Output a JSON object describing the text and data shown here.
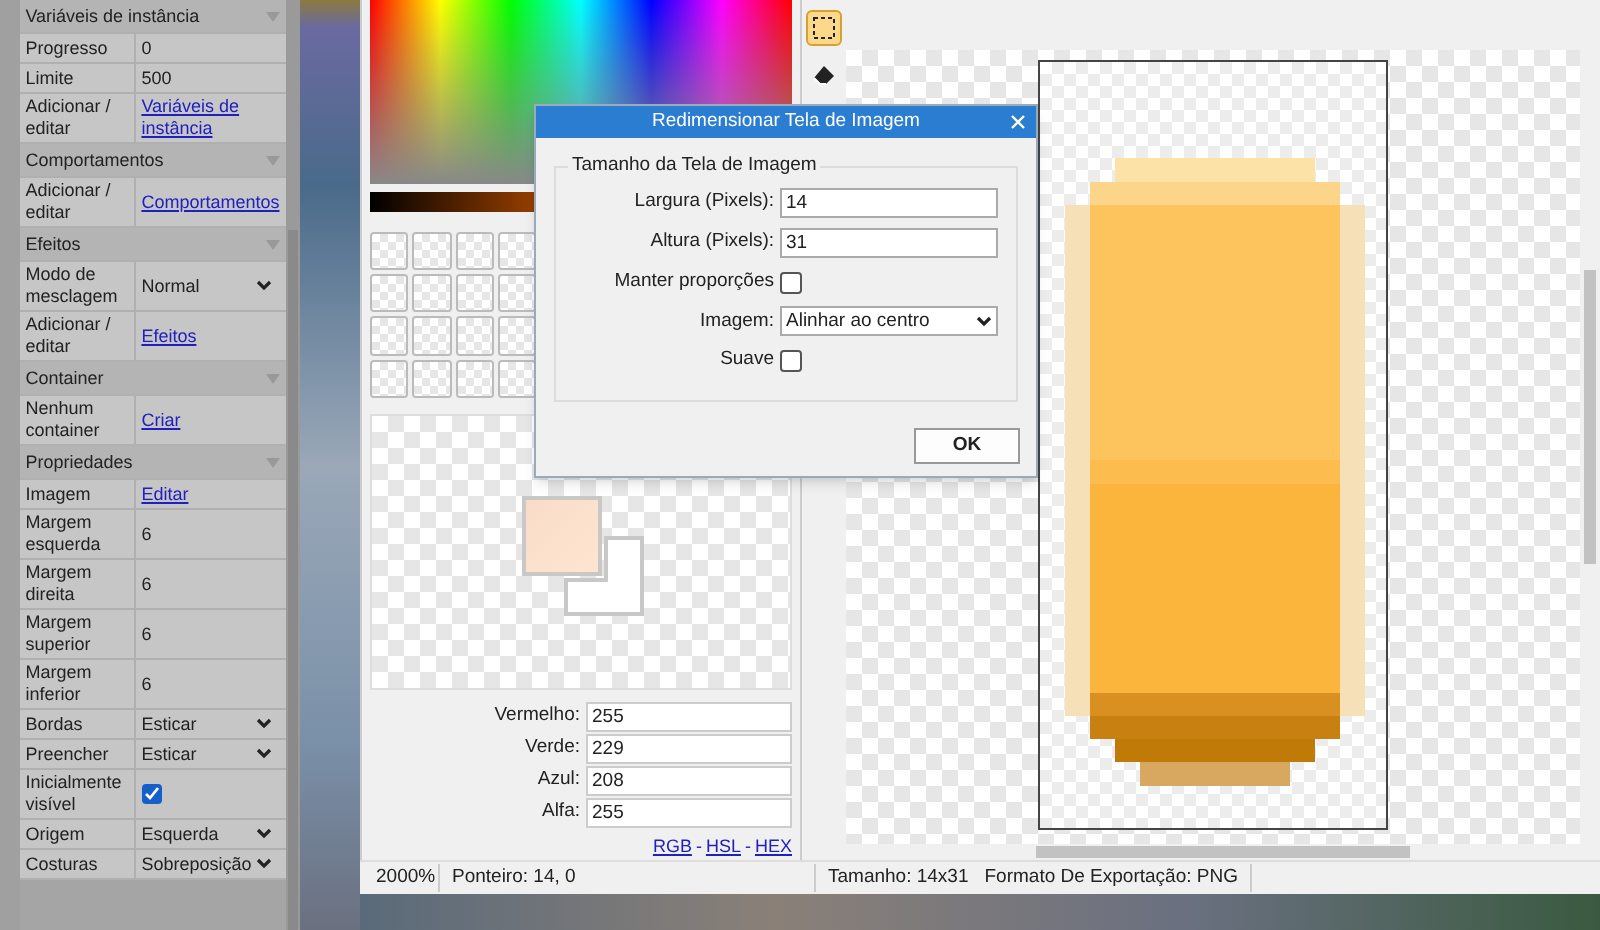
{
  "sidebar": {
    "sections": [
      {
        "title": "Variáveis de instância",
        "rows": [
          {
            "kind": "text",
            "label": "Progresso",
            "value": "0"
          },
          {
            "kind": "text",
            "label": "Limite",
            "value": "500"
          },
          {
            "kind": "link",
            "label": "Adicionar / editar",
            "value": "Variáveis de instância"
          }
        ]
      },
      {
        "title": "Comportamentos",
        "rows": [
          {
            "kind": "link",
            "label": "Adicionar / editar",
            "value": "Comportamentos"
          }
        ]
      },
      {
        "title": "Efeitos",
        "rows": [
          {
            "kind": "select",
            "label": "Modo de mesclagem",
            "value": "Normal"
          },
          {
            "kind": "link",
            "label": "Adicionar / editar",
            "value": "Efeitos"
          }
        ]
      },
      {
        "title": "Container",
        "rows": [
          {
            "kind": "link",
            "label": "Nenhum container",
            "value": "Criar"
          }
        ]
      },
      {
        "title": "Propriedades",
        "rows": [
          {
            "kind": "link",
            "label": "Imagem",
            "value": "Editar"
          },
          {
            "kind": "text",
            "label": "Margem esquerda",
            "value": "6"
          },
          {
            "kind": "text",
            "label": "Margem direita",
            "value": "6"
          },
          {
            "kind": "text",
            "label": "Margem superior",
            "value": "6"
          },
          {
            "kind": "text",
            "label": "Margem inferior",
            "value": "6"
          },
          {
            "kind": "select",
            "label": "Bordas",
            "value": "Esticar"
          },
          {
            "kind": "select",
            "label": "Preencher",
            "value": "Esticar"
          },
          {
            "kind": "checkbox",
            "label": "Inicialmente visível",
            "checked": true
          },
          {
            "kind": "select",
            "label": "Origem",
            "value": "Esquerda"
          },
          {
            "kind": "select",
            "label": "Costuras",
            "value": "Sobreposição"
          }
        ]
      }
    ]
  },
  "color_panel": {
    "channels": [
      {
        "label": "Vermelho:",
        "value": "255"
      },
      {
        "label": "Verde:",
        "value": "229"
      },
      {
        "label": "Azul:",
        "value": "208"
      },
      {
        "label": "Alfa:",
        "value": "255"
      }
    ],
    "links": [
      "RGB",
      "HSL",
      "HEX"
    ],
    "link_separator": "-"
  },
  "tools": [
    {
      "kind": "rect-select",
      "selected": true
    },
    {
      "kind": "eraser",
      "selected": false
    }
  ],
  "status_bar": {
    "zoom": "2000%",
    "pointer": "Ponteiro: 14, 0",
    "size": "Tamanho: 14x31",
    "export_format": "Formato De Exportação: PNG"
  },
  "dialog": {
    "title": "Redimensionar Tela de Imagem",
    "group_title": "Tamanho da Tela de Imagem",
    "fields": [
      {
        "kind": "text",
        "label": "Largura (Pixels):",
        "value": "14"
      },
      {
        "kind": "text",
        "label": "Altura (Pixels):",
        "value": "31"
      },
      {
        "kind": "checkbox",
        "label": "Manter proporções",
        "checked": false
      },
      {
        "kind": "select",
        "label": "Imagem:",
        "value": "Alinhar ao centro"
      },
      {
        "kind": "checkbox",
        "label": "Suave",
        "checked": false
      }
    ],
    "ok_button": "OK"
  }
}
